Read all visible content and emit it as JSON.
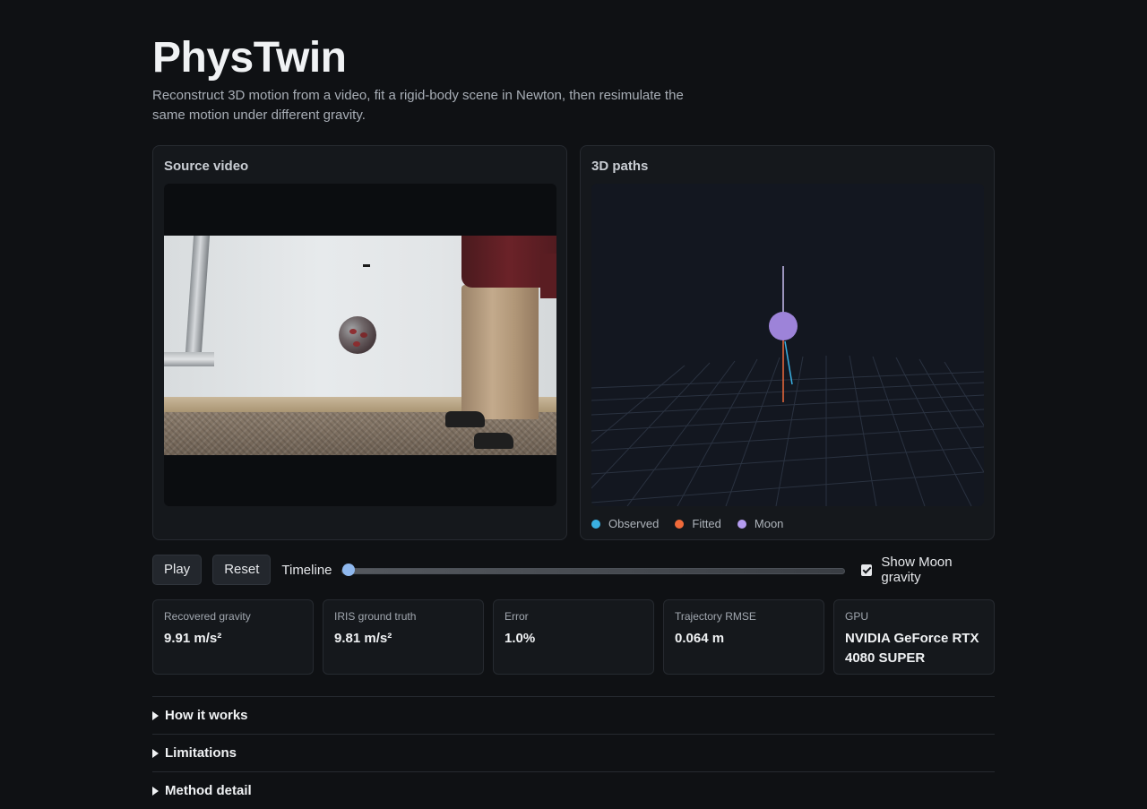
{
  "header": {
    "title": "PhysTwin",
    "subtitle": "Reconstruct 3D motion from a video, fit a rigid-body scene in Newton, then resimulate the same motion under different gravity."
  },
  "panels": {
    "video_title": "Source video",
    "paths_title": "3D paths"
  },
  "legend": [
    {
      "label": "Observed",
      "color": "#3ab0e2"
    },
    {
      "label": "Fitted",
      "color": "#f06a3a"
    },
    {
      "label": "Moon",
      "color": "#b49cf0"
    }
  ],
  "controls": {
    "play_label": "Play",
    "reset_label": "Reset",
    "timeline_label": "Timeline",
    "timeline_value": 0,
    "moon_label": "Show Moon gravity",
    "moon_checked": true
  },
  "stats": [
    {
      "label": "Recovered gravity",
      "value": "9.91 m/s²"
    },
    {
      "label": "IRIS ground truth",
      "value": "9.81 m/s²"
    },
    {
      "label": "Error",
      "value": "1.0%"
    },
    {
      "label": "Trajectory RMSE",
      "value": "0.064 m"
    },
    {
      "label": "GPU",
      "value": "NVIDIA GeForce RTX 4080 SUPER"
    }
  ],
  "details": [
    {
      "label": "How it works"
    },
    {
      "label": "Limitations"
    },
    {
      "label": "Method detail"
    }
  ]
}
